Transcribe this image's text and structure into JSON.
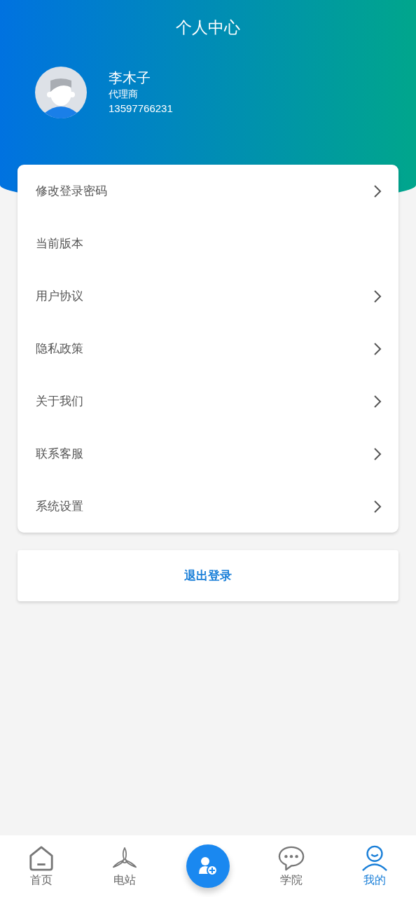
{
  "header": {
    "title": "个人中心"
  },
  "profile": {
    "name": "李木子",
    "role": "代理商",
    "phone": "13597766231"
  },
  "menu": [
    {
      "label": "修改登录密码",
      "arrow": true
    },
    {
      "label": "当前版本",
      "arrow": false
    },
    {
      "label": "用户协议",
      "arrow": true
    },
    {
      "label": "隐私政策",
      "arrow": true
    },
    {
      "label": "关于我们",
      "arrow": true
    },
    {
      "label": "联系客服",
      "arrow": true
    },
    {
      "label": "系统设置",
      "arrow": true
    }
  ],
  "logout": {
    "label": "退出登录"
  },
  "nav": [
    {
      "kind": "home",
      "label": "首页",
      "selected": false
    },
    {
      "kind": "fan",
      "label": "电站",
      "selected": false
    },
    {
      "kind": "add"
    },
    {
      "kind": "chat",
      "label": "学院",
      "selected": false
    },
    {
      "kind": "me",
      "label": "我的",
      "selected": true
    }
  ]
}
